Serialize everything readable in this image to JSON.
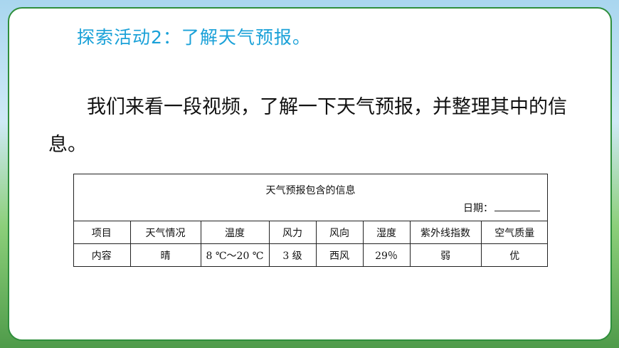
{
  "activity_title": "探索活动2：了解天气预报。",
  "paragraph": "我们来看一段视频，了解一下天气预报，并整理其中的信息。",
  "table": {
    "caption": "天气预报包含的信息",
    "date_label": "日期：",
    "header": [
      "项目",
      "天气情况",
      "温度",
      "风力",
      "风向",
      "湿度",
      "紫外线指数",
      "空气质量"
    ],
    "row": [
      "内容",
      "晴",
      "8 ℃～20 ℃",
      "3 级",
      "西风",
      "29％",
      "弱",
      "优"
    ]
  },
  "colors": {
    "title": "#1aa1d8",
    "card_border": "#2f8f3c"
  }
}
